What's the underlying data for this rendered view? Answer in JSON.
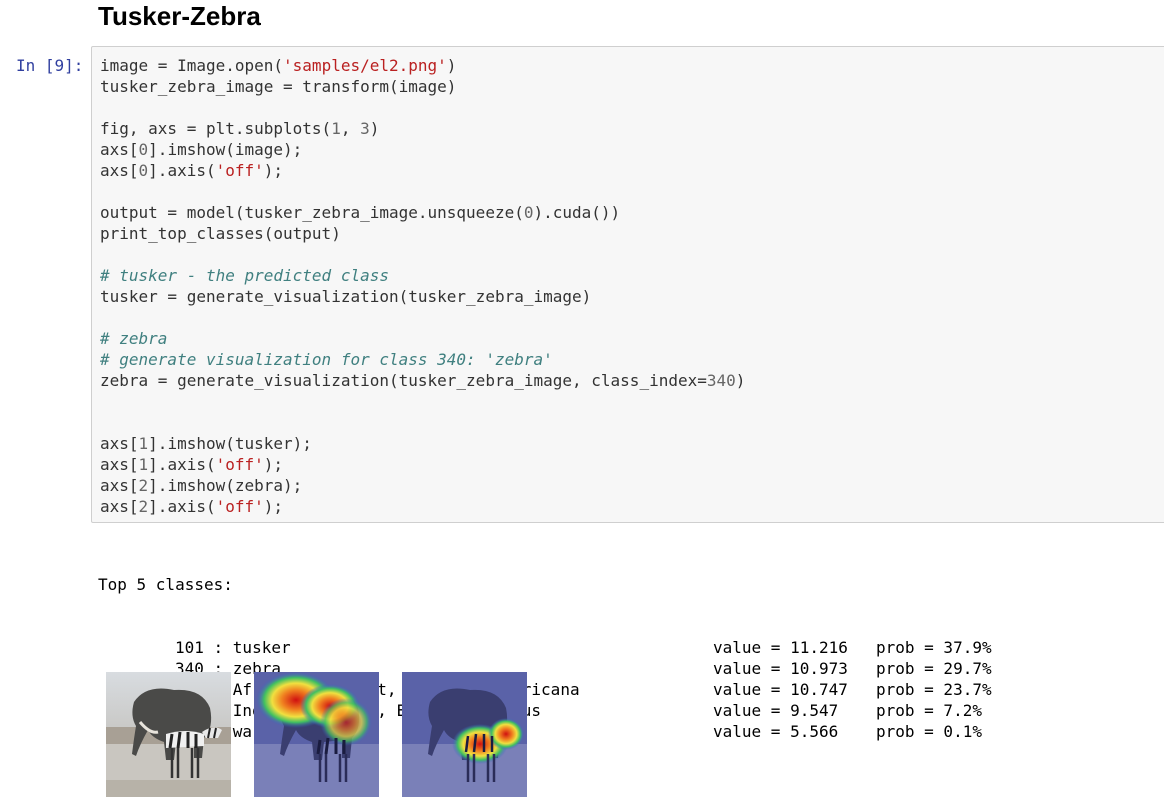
{
  "heading": "Tusker-Zebra",
  "cell": {
    "prompt": "In [9]:",
    "lines": [
      [
        {
          "t": "image = Image.open("
        },
        {
          "t": "'samples/el2.png'",
          "c": "str"
        },
        {
          "t": ")"
        }
      ],
      [
        {
          "t": "tusker_zebra_image = transform(image)"
        }
      ],
      [],
      [
        {
          "t": "fig, axs = plt.subplots("
        },
        {
          "t": "1",
          "c": "num"
        },
        {
          "t": ", "
        },
        {
          "t": "3",
          "c": "num"
        },
        {
          "t": ")"
        }
      ],
      [
        {
          "t": "axs["
        },
        {
          "t": "0",
          "c": "num"
        },
        {
          "t": "].imshow(image);"
        }
      ],
      [
        {
          "t": "axs["
        },
        {
          "t": "0",
          "c": "num"
        },
        {
          "t": "].axis("
        },
        {
          "t": "'off'",
          "c": "str"
        },
        {
          "t": ");"
        }
      ],
      [],
      [
        {
          "t": "output = model(tusker_zebra_image.unsqueeze("
        },
        {
          "t": "0",
          "c": "num"
        },
        {
          "t": ").cuda())"
        }
      ],
      [
        {
          "t": "print_top_classes(output)"
        }
      ],
      [],
      [
        {
          "t": "# tusker - the predicted class",
          "c": "cm"
        }
      ],
      [
        {
          "t": "tusker = generate_visualization(tusker_zebra_image)"
        }
      ],
      [],
      [
        {
          "t": "# zebra",
          "c": "cm"
        }
      ],
      [
        {
          "t": "# generate visualization for class 340: 'zebra'",
          "c": "cm"
        }
      ],
      [
        {
          "t": "zebra = generate_visualization(tusker_zebra_image, class_index="
        },
        {
          "t": "340",
          "c": "num"
        },
        {
          "t": ")"
        }
      ],
      [],
      [],
      [
        {
          "t": "axs["
        },
        {
          "t": "1",
          "c": "num"
        },
        {
          "t": "].imshow(tusker);"
        }
      ],
      [
        {
          "t": "axs["
        },
        {
          "t": "1",
          "c": "num"
        },
        {
          "t": "].axis("
        },
        {
          "t": "'off'",
          "c": "str"
        },
        {
          "t": ");"
        }
      ],
      [
        {
          "t": "axs["
        },
        {
          "t": "2",
          "c": "num"
        },
        {
          "t": "].imshow(zebra);"
        }
      ],
      [
        {
          "t": "axs["
        },
        {
          "t": "2",
          "c": "num"
        },
        {
          "t": "].axis("
        },
        {
          "t": "'off'",
          "c": "str"
        },
        {
          "t": ");"
        }
      ]
    ]
  },
  "output": {
    "title": "Top 5 classes:",
    "rows": [
      {
        "cls": "101 : tusker",
        "value": "value = 11.216",
        "prob": "prob = 37.9%"
      },
      {
        "cls": "340 : zebra",
        "value": "value = 10.973",
        "prob": "prob = 29.7%"
      },
      {
        "cls": "386 : African elephant, Loxodonta africana",
        "value": "value = 10.747",
        "prob": "prob = 23.7%"
      },
      {
        "cls": "385 : Indian elephant, Elephas maximus",
        "value": "value = 9.547",
        "prob": "prob = 7.2%"
      },
      {
        "cls": "343 : warthog",
        "value": "value = 5.566",
        "prob": "prob = 0.1%"
      }
    ]
  },
  "figures": [
    {
      "name": "original-image"
    },
    {
      "name": "tusker-heatmap-image"
    },
    {
      "name": "zebra-heatmap-image"
    }
  ],
  "colors": {
    "prompt": "#303f9f",
    "string": "#ba2121",
    "number": "#666666",
    "comment": "#408080",
    "cell_bg": "#f7f7f7",
    "cell_border": "#cfcfcf"
  }
}
